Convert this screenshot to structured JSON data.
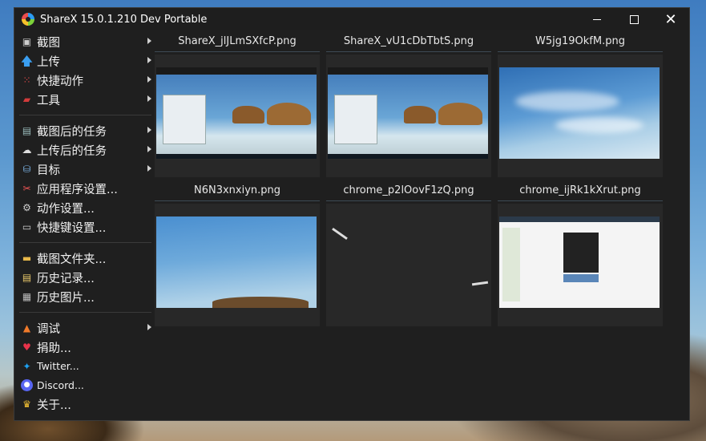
{
  "window": {
    "title": "ShareX 15.0.1.210 Dev Portable"
  },
  "menu": {
    "group1": [
      {
        "label": "截图",
        "icon": "screenshot-icon",
        "submenu": true
      },
      {
        "label": "上传",
        "icon": "upload-arrow-icon",
        "submenu": true
      },
      {
        "label": "快捷动作",
        "icon": "workflow-grid-icon",
        "submenu": true
      },
      {
        "label": "工具",
        "icon": "toolbox-icon",
        "submenu": true
      }
    ],
    "group2": [
      {
        "label": "截图后的任务",
        "icon": "after-capture-icon",
        "submenu": true
      },
      {
        "label": "上传后的任务",
        "icon": "after-upload-icon",
        "submenu": true
      },
      {
        "label": "目标",
        "icon": "destination-icon",
        "submenu": true
      },
      {
        "label": "应用程序设置...",
        "icon": "settings-tools-icon",
        "submenu": false
      },
      {
        "label": "动作设置...",
        "icon": "gear-icon",
        "submenu": false
      },
      {
        "label": "快捷键设置...",
        "icon": "keyboard-icon",
        "submenu": false
      }
    ],
    "group3": [
      {
        "label": "截图文件夹...",
        "icon": "folder-icon",
        "submenu": false
      },
      {
        "label": "历史记录...",
        "icon": "history-icon",
        "submenu": false
      },
      {
        "label": "历史图片...",
        "icon": "image-history-icon",
        "submenu": false
      }
    ],
    "group4": [
      {
        "label": "调试",
        "icon": "debug-cone-icon",
        "submenu": true
      },
      {
        "label": "捐助...",
        "icon": "heart-icon",
        "submenu": false
      },
      {
        "label": "Twitter...",
        "icon": "twitter-icon",
        "submenu": false
      },
      {
        "label": "Discord...",
        "icon": "discord-icon",
        "submenu": false
      },
      {
        "label": "关于...",
        "icon": "crown-icon",
        "submenu": false
      }
    ]
  },
  "thumbnails": [
    {
      "filename": "ShareX_jlJLmSXfcP.png",
      "preview": "desktop"
    },
    {
      "filename": "ShareX_vU1cDbTbtS.png",
      "preview": "desktop"
    },
    {
      "filename": "W5jg19OkfM.png",
      "preview": "sky"
    },
    {
      "filename": "N6N3xnxiyn.png",
      "preview": "sky-hill"
    },
    {
      "filename": "chrome_p2lOovF1zQ.png",
      "preview": "blank"
    },
    {
      "filename": "chrome_ijRk1kXrut.png",
      "preview": "webpage"
    }
  ],
  "colors": {
    "window_bg": "#1f1f1f",
    "text": "#f0f0f0",
    "separator": "#3a3a3a"
  }
}
